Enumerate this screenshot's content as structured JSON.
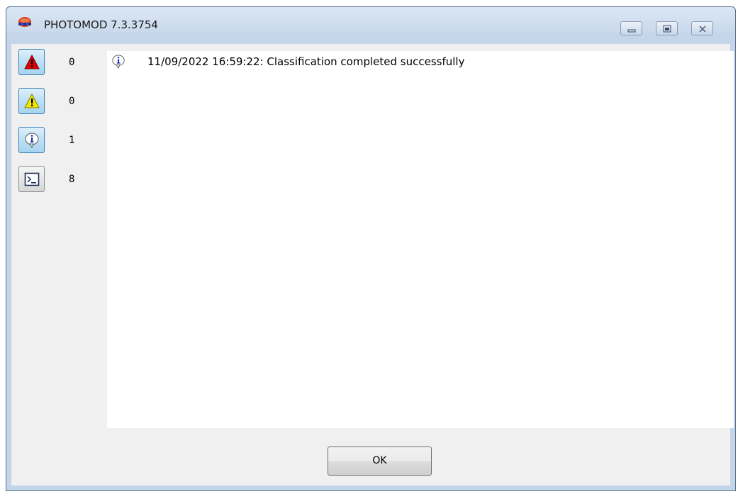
{
  "window": {
    "title": "PHOTOMOD 7.3.3754",
    "controls": [
      "minimize",
      "restore",
      "close"
    ]
  },
  "filters": [
    {
      "type": "error",
      "icon": "error-icon",
      "count": "0",
      "pressed": true
    },
    {
      "type": "warning",
      "icon": "warning-icon",
      "count": "0",
      "pressed": true
    },
    {
      "type": "info",
      "icon": "info-icon",
      "count": "1",
      "pressed": true
    },
    {
      "type": "console",
      "icon": "console-icon",
      "count": "8",
      "pressed": false
    }
  ],
  "messages": [
    {
      "icon": "info-icon",
      "text": "11/09/2022 16:59:22: Classification completed successfully"
    }
  ],
  "buttons": {
    "ok": "OK"
  },
  "colors": {
    "error": "#e00000",
    "warning": "#f5e800",
    "info": "#1a2fb5",
    "pressed_button": "#bfe1f6",
    "titlebar": "#c9d9ec"
  }
}
